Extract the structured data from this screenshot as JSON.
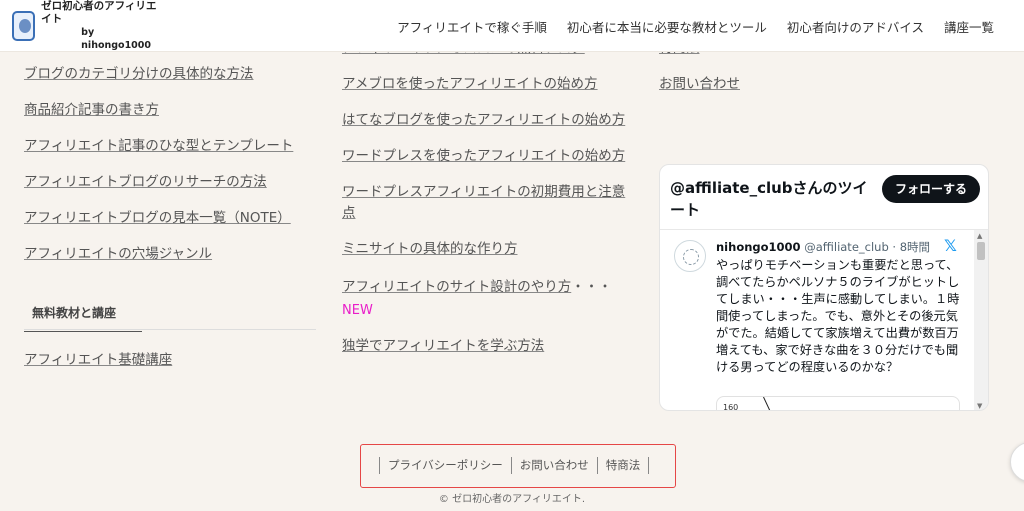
{
  "header": {
    "logo_title": "ゼロ初心者のアフィリエイト",
    "logo_sub": "by nihongo1000",
    "nav": [
      "アフィリエイトで稼ぐ手順",
      "初心者に本当に必要な教材とツール",
      "初心者向けのアドバイス",
      "講座一覧"
    ]
  },
  "col1": {
    "links": [
      "ブログのカテゴリ分けの具体的な方法",
      "商品紹介記事の書き方",
      "アフィリエイト記事のひな型とテンプレート",
      "アフィリエイトブログのリサーチの方法",
      "アフィリエイトブログの見本一覧（NOTE）",
      "アフィリエイトの穴場ジャンル"
    ],
    "section_title": "無料教材と講座",
    "section_link": "アフィリエイト基礎講座"
  },
  "col2": {
    "cut_link": "アフィリエイトにオススメの無料ブログ",
    "links": [
      "アメブロを使ったアフィリエイトの始め方",
      "はてなブログを使ったアフィリエイトの始め方",
      "ワードプレスを使ったアフィリエイトの始め方",
      "ワードプレスアフィリエイトの初期費用と注意点",
      "ミニサイトの具体的な作り方"
    ],
    "design_link": "アフィリエイトのサイト設計のやり方",
    "design_suffix": "・・・",
    "new_badge": "NEW",
    "last_link": "独学でアフィリエイトを学ぶ方法"
  },
  "col3": {
    "links": [
      "特商法",
      "お問い合わせ"
    ]
  },
  "twitter": {
    "title": "@affiliate_clubさんのツイート",
    "follow_label": "フォローする",
    "user_name": "nihongo1000",
    "user_handle": "@affiliate_club · 8時間",
    "tweet_text": "やっぱりモチベーションも重要だと思って、調べてたらかペルソナ５のライブがヒットしてしまい・・・生声に感動してしまい。１時間使ってしまった。でも、意外とその後元気がでた。結婚してて家族増えて出費が数百万増えても、家で好きな曲を３０分だけでも聞ける男ってどの程度いるのかな？",
    "image_label": "160"
  },
  "footer": {
    "links": [
      "プライバシーポリシー",
      "お問い合わせ",
      "特商法"
    ],
    "copyright": "© ゼロ初心者のアフィリエイト."
  },
  "colors": {
    "background": "#f7f3ee",
    "new_badge": "#e91ec9",
    "highlight_box": "#e54646",
    "follow_button": "#0f1419"
  }
}
